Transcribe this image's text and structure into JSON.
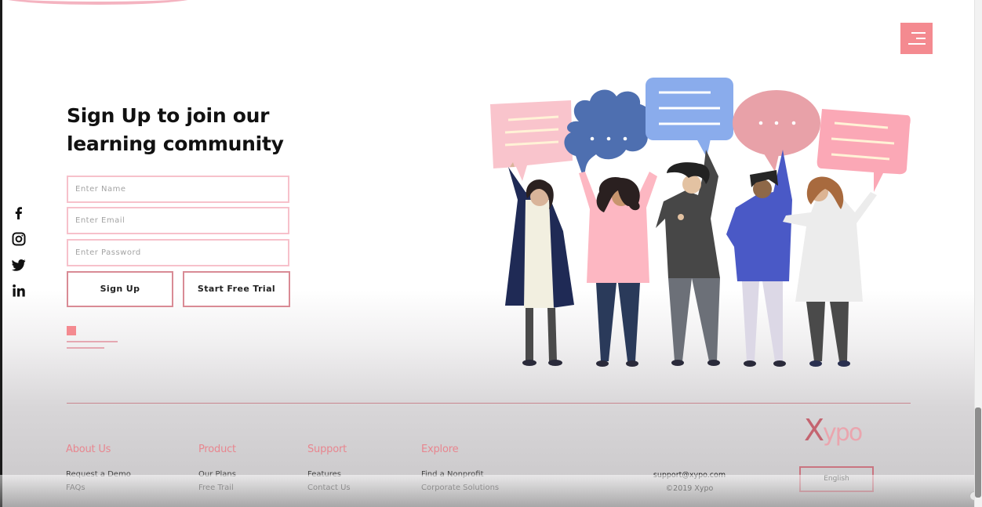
{
  "header": {
    "menu_icon": "hamburger-menu-icon"
  },
  "hero": {
    "headline_line1": "Sign Up to join our",
    "headline_line2": "learning community"
  },
  "form": {
    "name_placeholder": "Enter Name",
    "email_placeholder": "Enter Email",
    "password_placeholder": "Enter Password",
    "signup_label": "Sign Up",
    "trial_label": "Start Free Trial"
  },
  "social": {
    "items": [
      "facebook-icon",
      "instagram-icon",
      "twitter-icon",
      "linkedin-icon"
    ]
  },
  "colors": {
    "accent": "#f48a90",
    "field_border": "#f7c1cb",
    "footer_heading": "#e8868f",
    "logo_dark": "#c46470",
    "logo_light": "#eaa5ae"
  },
  "footer": {
    "columns": [
      {
        "heading": "About Us",
        "links": [
          "Request a Demo",
          "FAQs"
        ]
      },
      {
        "heading": "Product",
        "links": [
          "Our Plans",
          "Free Trail"
        ]
      },
      {
        "heading": "Support",
        "links": [
          "Features",
          "Contact Us"
        ]
      },
      {
        "heading": "Explore",
        "links": [
          "Find a Nonprofit",
          "Corporate Solutions"
        ]
      }
    ],
    "email": "support@xypo.com",
    "copyright": "©2019 Xypo",
    "logo_x": "X",
    "logo_rest": "ypo",
    "language_label": "English"
  }
}
